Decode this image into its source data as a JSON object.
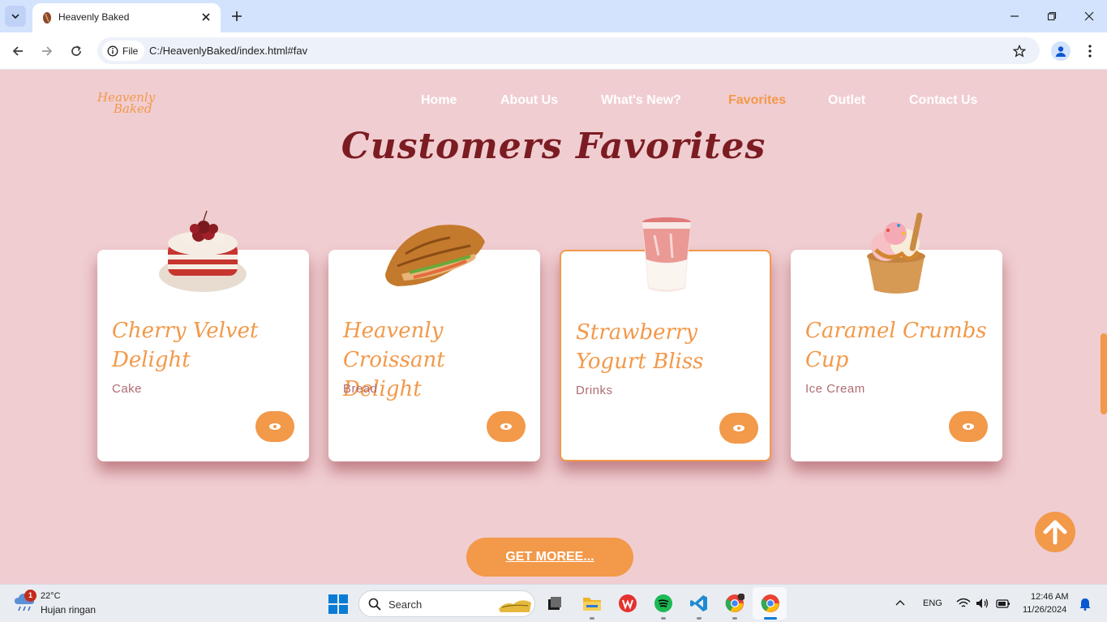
{
  "browser": {
    "tab_title": "Heavenly Baked",
    "site_chip": "File",
    "url": "C:/HeavenlyBaked/index.html#fav"
  },
  "site": {
    "logo_line1": "Heavenly",
    "logo_line2": "Baked",
    "nav": [
      {
        "label": "Home"
      },
      {
        "label": "About Us"
      },
      {
        "label": "What's New?"
      },
      {
        "label": "Favorites",
        "active": true
      },
      {
        "label": "Outlet"
      },
      {
        "label": "Contact Us"
      }
    ],
    "heading": "Customers Favorites",
    "cards": [
      {
        "title": "Cherry Velvet Delight",
        "category": "Cake",
        "image": "cake-image"
      },
      {
        "title": "Heavenly Croissant Delight",
        "category": "Bread",
        "image": "croissant-image"
      },
      {
        "title": "Strawberry Yogurt Bliss",
        "category": "Drinks",
        "image": "drink-image"
      },
      {
        "title": "Caramel Crumbs Cup",
        "category": "Ice Cream",
        "image": "ice-cream-image"
      }
    ],
    "get_more": "GET MOREE...",
    "colors": {
      "accent": "#f2994a",
      "heading": "#7b1c22",
      "background": "#f0cdd1"
    }
  },
  "taskbar": {
    "weather_temp": "22°C",
    "weather_desc": "Hujan ringan",
    "weather_badge": "1",
    "search_label": "Search",
    "language": "ENG",
    "time": "12:46 AM",
    "date": "11/26/2024"
  }
}
